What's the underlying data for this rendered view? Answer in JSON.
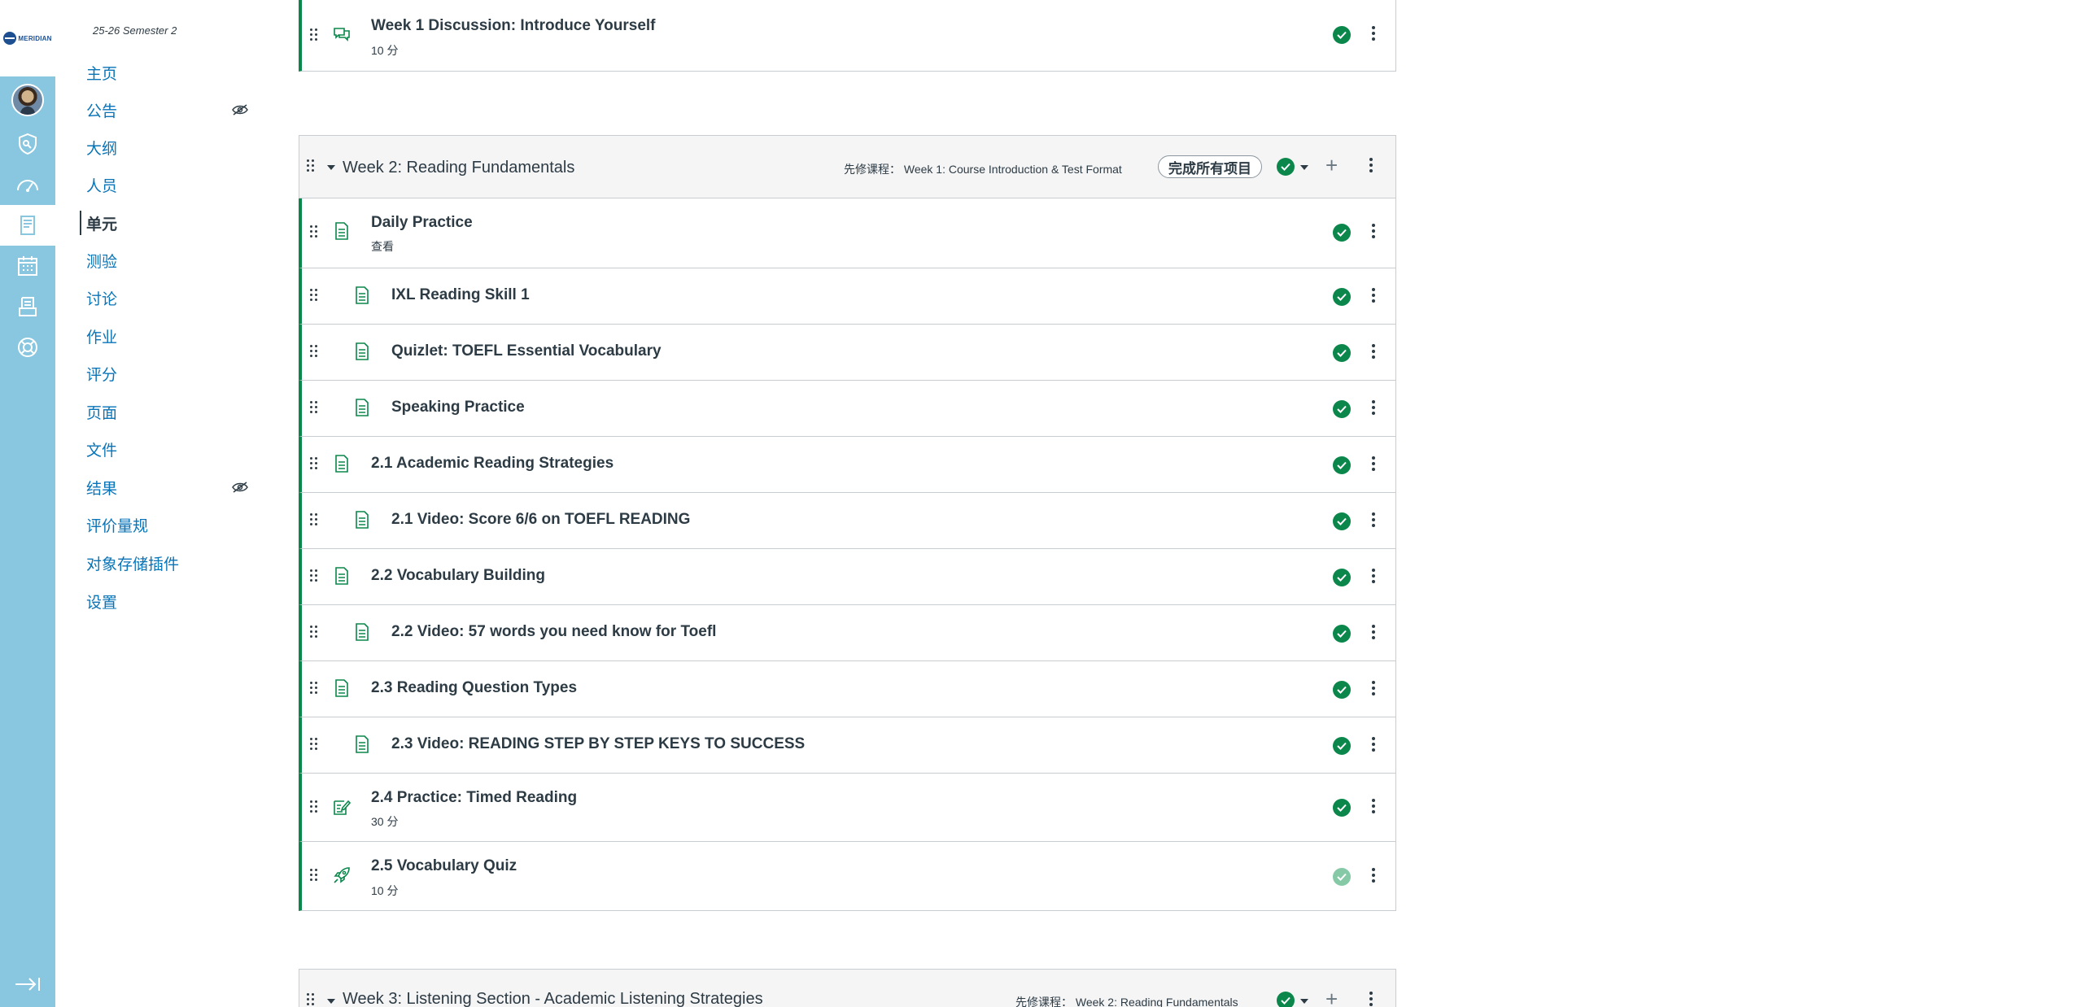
{
  "brand": {
    "logo_text": "MERIDIAN"
  },
  "course_nav": {
    "term": "25-26 Semester 2",
    "items": [
      {
        "label": "主页",
        "hidden": false,
        "active": false
      },
      {
        "label": "公告",
        "hidden": true,
        "active": false
      },
      {
        "label": "大纲",
        "hidden": false,
        "active": false
      },
      {
        "label": "人员",
        "hidden": false,
        "active": false
      },
      {
        "label": "单元",
        "hidden": false,
        "active": true
      },
      {
        "label": "测验",
        "hidden": false,
        "active": false
      },
      {
        "label": "讨论",
        "hidden": false,
        "active": false
      },
      {
        "label": "作业",
        "hidden": false,
        "active": false
      },
      {
        "label": "评分",
        "hidden": false,
        "active": false
      },
      {
        "label": "页面",
        "hidden": false,
        "active": false
      },
      {
        "label": "文件",
        "hidden": false,
        "active": false
      },
      {
        "label": "结果",
        "hidden": true,
        "active": false
      },
      {
        "label": "评价量规",
        "hidden": false,
        "active": false
      },
      {
        "label": "对象存储插件",
        "hidden": false,
        "active": false
      },
      {
        "label": "设置",
        "hidden": false,
        "active": false
      }
    ]
  },
  "prev_item": {
    "title": "Week 1 Discussion: Introduce Yourself",
    "sub": "10 分",
    "icon": "discussion-icon"
  },
  "week2": {
    "title": "Week 2: Reading Fundamentals",
    "prereq": "先修课程：  Week 1: Course Introduction & Test Format",
    "requirement": "完成所有项目",
    "items": [
      {
        "title": "Daily Practice",
        "sub": "查看",
        "indent": false,
        "icon": "page-icon",
        "faded": false
      },
      {
        "title": "IXL Reading Skill 1",
        "sub": "",
        "indent": true,
        "icon": "page-icon",
        "faded": false
      },
      {
        "title": "Quizlet: TOEFL Essential Vocabulary",
        "sub": "",
        "indent": true,
        "icon": "page-icon",
        "faded": false
      },
      {
        "title": "Speaking Practice",
        "sub": "",
        "indent": true,
        "icon": "page-icon",
        "faded": false
      },
      {
        "title": "2.1 Academic Reading Strategies",
        "sub": "",
        "indent": false,
        "icon": "page-icon",
        "faded": false
      },
      {
        "title": "2.1 Video: Score 6/6 on TOEFL READING",
        "sub": "",
        "indent": true,
        "icon": "page-icon",
        "faded": false
      },
      {
        "title": "2.2 Vocabulary Building",
        "sub": "",
        "indent": false,
        "icon": "page-icon",
        "faded": false
      },
      {
        "title": "2.2 Video: 57 words you need know for Toefl",
        "sub": "",
        "indent": true,
        "icon": "page-icon",
        "faded": false
      },
      {
        "title": "2.3 Reading Question Types",
        "sub": "",
        "indent": false,
        "icon": "page-icon",
        "faded": false
      },
      {
        "title": "2.3 Video: READING STEP BY STEP KEYS TO SUCCESS",
        "sub": "",
        "indent": true,
        "icon": "page-icon",
        "faded": false
      },
      {
        "title": "2.4 Practice: Timed Reading",
        "sub": "30 分",
        "indent": false,
        "icon": "assignment-icon",
        "faded": false
      },
      {
        "title": "2.5 Vocabulary Quiz",
        "sub": "10 分",
        "indent": false,
        "icon": "quiz-rocket-icon",
        "faded": true
      }
    ]
  },
  "week3": {
    "title": "Week 3: Listening Section - Academic Listening Strategies",
    "prereq": "先修课程：  Week 2: Reading Fundamentals"
  }
}
